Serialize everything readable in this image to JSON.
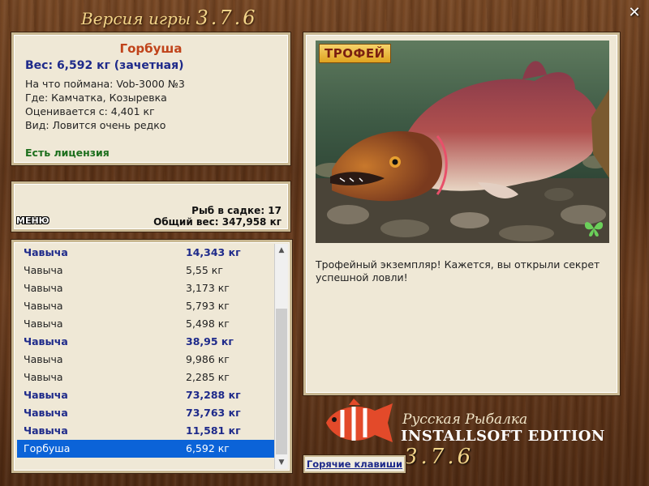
{
  "header": {
    "title_prefix": "Версия игры",
    "version": "3.7.6"
  },
  "info": {
    "fish_name": "Горбуша",
    "weight": "Вес: 6,592 кг (зачетная)",
    "caught_on": "На что поймана: Vob-3000 №3",
    "location": "Где: Камчатка, Козыревка",
    "rated_from": "Оценивается с: 4,401 кг",
    "kind": "Вид: Ловится очень редко",
    "license": "Есть лицензия"
  },
  "summary": {
    "menu_label": "МЕНЮ",
    "fish_count": "Рыб в садке: 17",
    "total_weight": "Общий вес: 347,958 кг"
  },
  "catch_list": [
    {
      "name": "Чавыча",
      "weight": "14,343 кг",
      "bold": true
    },
    {
      "name": "Чавыча",
      "weight": "5,55 кг",
      "bold": false
    },
    {
      "name": "Чавыча",
      "weight": "3,173 кг",
      "bold": false
    },
    {
      "name": "Чавыча",
      "weight": "5,793 кг",
      "bold": false
    },
    {
      "name": "Чавыча",
      "weight": "5,498 кг",
      "bold": false
    },
    {
      "name": "Чавыча",
      "weight": "38,95 кг",
      "bold": true
    },
    {
      "name": "Чавыча",
      "weight": "9,986 кг",
      "bold": false
    },
    {
      "name": "Чавыча",
      "weight": "2,285 кг",
      "bold": false
    },
    {
      "name": "Чавыча",
      "weight": "73,288 кг",
      "bold": true
    },
    {
      "name": "Чавыча",
      "weight": "73,763 кг",
      "bold": true
    },
    {
      "name": "Чавыча",
      "weight": "11,581 кг",
      "bold": true
    },
    {
      "name": "Горбуша",
      "weight": "6,592 кг",
      "bold": false,
      "selected": true
    }
  ],
  "photo": {
    "badge": "ТРОФЕЙ",
    "description": "Трофейный экземпляр! Кажется, вы открыли секрет успешной ловли!"
  },
  "footer": {
    "hotkeys_label": "Горячие клавиши",
    "brand_line1": "Русская Рыбалка",
    "brand_line2": "INSTALLSOFT EDITION",
    "brand_version": "3.7.6"
  },
  "colors": {
    "selected_row": "#0b63d8",
    "bold_row": "#1e2a8a",
    "fish_name": "#c0431a",
    "license": "#1c6e1c"
  },
  "icons": {
    "close": "close-icon",
    "butterfly": "butterfly-icon"
  }
}
